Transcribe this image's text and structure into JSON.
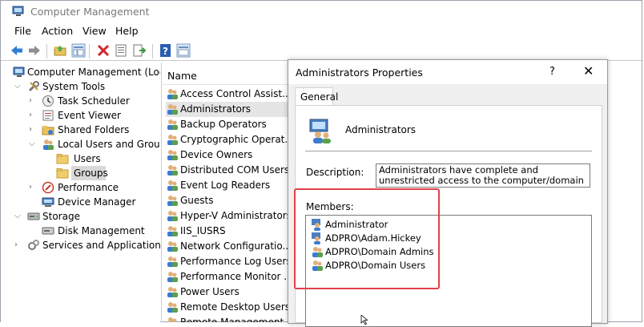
{
  "window": {
    "title": "Computer Management"
  },
  "menu": {
    "items": [
      "File",
      "Action",
      "View",
      "Help"
    ]
  },
  "toolbar": {
    "icons": [
      "back-arrow-icon",
      "forward-arrow-icon",
      "up-folder-icon",
      "show-hide-tree-icon",
      "delete-icon",
      "properties-icon",
      "export-list-icon",
      "help-icon",
      "mmc-console-icon"
    ]
  },
  "tree": {
    "root": "Computer Management (Local",
    "system_tools": "System Tools",
    "task_scheduler": "Task Scheduler",
    "event_viewer": "Event Viewer",
    "shared_folders": "Shared Folders",
    "local_users_groups": "Local Users and Groups",
    "users": "Users",
    "groups": "Groups",
    "performance": "Performance",
    "device_manager": "Device Manager",
    "storage": "Storage",
    "disk_management": "Disk Management",
    "services_apps": "Services and Applications"
  },
  "list": {
    "header": "Name",
    "rows": [
      "Access Control Assist...",
      "Administrators",
      "Backup Operators",
      "Cryptographic Operat...",
      "Device Owners",
      "Distributed COM Users",
      "Event Log Readers",
      "Guests",
      "Hyper-V Administrators",
      "IIS_IUSRS",
      "Network Configuratio...",
      "Performance Log Users",
      "Performance Monitor ...",
      "Power Users",
      "Remote Desktop Users",
      "Remote Management ..."
    ],
    "selected_index": 1
  },
  "dialog": {
    "title": "Administrators Properties",
    "help": "?",
    "close": "✕",
    "tab": "General",
    "group_name": "Administrators",
    "description_label": "Description:",
    "description": "Administrators have complete and unrestricted access to the computer/domain",
    "members_label": "Members:",
    "members": [
      "Administrator",
      "ADPRO\\Adam.Hickey",
      "ADPRO\\Domain Admins",
      "ADPRO\\Domain Users"
    ]
  },
  "colors": {
    "highlight": "#e0414b",
    "selection": "#d9d9d9",
    "accent": "#1a6fc9"
  }
}
